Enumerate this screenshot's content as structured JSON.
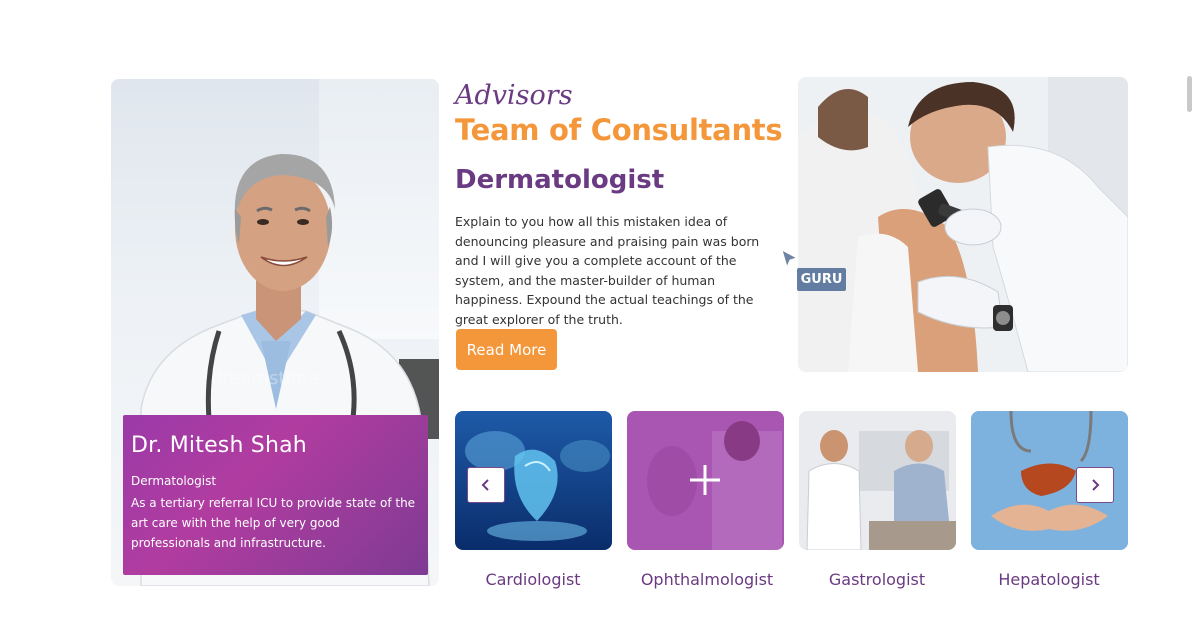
{
  "section": {
    "kicker": "Advisors",
    "title": "Team of Consultants",
    "specialty": "Dermatologist",
    "description": "Explain to you how all this mistaken idea of denouncing pleasure and praising pain was born and I will give you a complete account of the system, and the master-builder of human happiness. Expound the actual teachings of the great explorer of the truth.",
    "read_more_label": "Read More"
  },
  "featured_doctor": {
    "name": "Dr. Mitesh Shah",
    "role": "Dermatologist",
    "description": "As a tertiary referral ICU to provide state of the art care with the help of very good professionals and infrastructure."
  },
  "guru_tag": "GURU",
  "specialties": [
    {
      "label": "Cardiologist",
      "image": "heart-hologram"
    },
    {
      "label": "Ophthalmologist",
      "image": "eye-exam"
    },
    {
      "label": "Gastrologist",
      "image": "patient-consult"
    },
    {
      "label": "Hepatologist",
      "image": "liver-in-hands"
    }
  ],
  "icons": {
    "prev": "chevron-left-icon",
    "next": "chevron-right-icon",
    "hover": "plus-icon",
    "pointer": "cursor-icon"
  },
  "colors": {
    "brand_purple": "#6a3a82",
    "accent_orange": "#f4963a",
    "overlay_magenta": "#b13ca0"
  }
}
